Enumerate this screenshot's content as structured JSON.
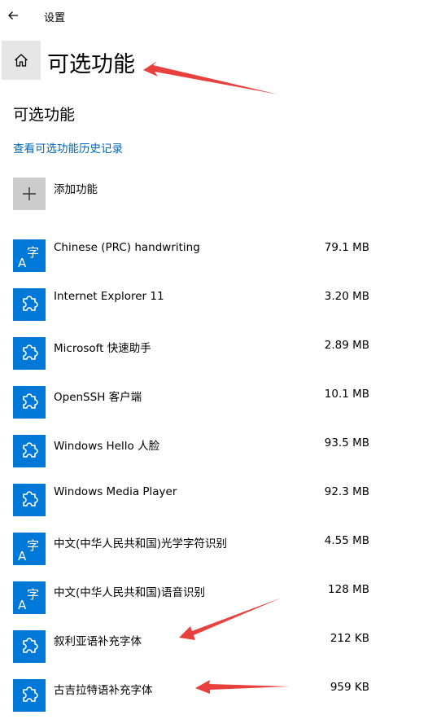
{
  "window": {
    "title": "设置"
  },
  "header": {
    "page_title": "可选功能"
  },
  "main": {
    "section_title": "可选功能",
    "history_link": "查看可选功能历史记录",
    "add_feature_label": "添加功能",
    "features": [
      {
        "name": "Chinese (PRC) handwriting",
        "size": "79.1 MB",
        "icon": "language-font-icon"
      },
      {
        "name": "Internet Explorer 11",
        "size": "3.20 MB",
        "icon": "puzzle-icon"
      },
      {
        "name": "Microsoft 快速助手",
        "size": "2.89 MB",
        "icon": "puzzle-icon"
      },
      {
        "name": "OpenSSH 客户端",
        "size": "10.1 MB",
        "icon": "puzzle-icon"
      },
      {
        "name": "Windows Hello 人脸",
        "size": "93.5 MB",
        "icon": "puzzle-icon"
      },
      {
        "name": "Windows Media Player",
        "size": "92.3 MB",
        "icon": "puzzle-icon"
      },
      {
        "name": "中文(中华人民共和国)光学字符识别",
        "size": "4.55 MB",
        "icon": "language-font-icon"
      },
      {
        "name": "中文(中华人民共和国)语音识别",
        "size": "128 MB",
        "icon": "language-font-icon"
      },
      {
        "name": "叙利亚语补充字体",
        "size": "212 KB",
        "icon": "puzzle-icon"
      },
      {
        "name": "古吉拉特语补充字体",
        "size": "959 KB",
        "icon": "puzzle-icon"
      }
    ]
  },
  "colors": {
    "accent": "#0078d7",
    "link": "#0067b8",
    "annotation_arrow": "#e8403c"
  }
}
